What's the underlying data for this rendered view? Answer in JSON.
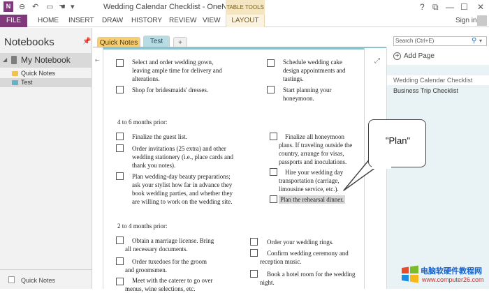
{
  "window": {
    "title": "Wedding Calendar Checklist - OneNote",
    "contextual_group": "TABLE TOOLS",
    "buttons": {
      "help": "?",
      "restore": "⧉",
      "minimize": "—",
      "maximize": "☐",
      "close": "✕"
    }
  },
  "ribbon": {
    "tabs": [
      "FILE",
      "HOME",
      "INSERT",
      "DRAW",
      "HISTORY",
      "REVIEW",
      "VIEW",
      "LAYOUT"
    ],
    "sign_in": "Sign in"
  },
  "notebooks": {
    "title": "Notebooks",
    "notebook": "My Notebook",
    "sections": [
      {
        "label": "Quick Notes",
        "color": "#f3c14f"
      },
      {
        "label": "Test",
        "color": "#5fb4c8"
      }
    ],
    "bottom_label": "Quick Notes"
  },
  "section_tabs": [
    {
      "label": "Quick Notes"
    },
    {
      "label": "Test"
    },
    {
      "label": "+"
    }
  ],
  "search": {
    "placeholder": "Search (Ctrl+E)"
  },
  "pages_pane": {
    "add_page": "Add Page",
    "pages": [
      "Wedding Calendar Checklist",
      "Business Trip Checklist"
    ]
  },
  "content": {
    "top_left": [
      "Select and order wedding gown,\nleaving ample time for delivery and\nalterations.",
      "Shop for bridesmaids' dresses."
    ],
    "top_right": [
      "Schedule wedding cake\ndesign appointments and\ntastings.",
      "Start planning your\nhoneymoon."
    ],
    "heading_1": "4 to 6 months prior:",
    "mid_left": [
      "Finalize the guest list.",
      "Order invitations (25 extra) and other\nwedding stationery (i.e., place cards and\nthank you notes).",
      "Plan wedding-day beauty preparations;\nask your stylist how far in advance they\nbook wedding parties, and whether they\nare willing to work on the wedding site."
    ],
    "mid_right": [
      "Finalize all honeymoon\nplans. If traveling outside the\ncountry, arrange for visas,\npassports and inoculations.",
      "Hire your wedding day\ntransportation (carriage,\nlimousine service, etc.).",
      "Plan the rehearsal dinner."
    ],
    "heading_2": "2 to 4 months prior:",
    "bottom_left": [
      "Obtain a marriage license. Bring\nall necessary documents.",
      "Order tuxedoes for the groom\nand groomsmen.",
      "Meet with the caterer to go over\nmenus, wine selections, etc."
    ],
    "bottom_right": [
      "Order your wedding rings.",
      "Confirm wedding ceremony and\nreception music.",
      "Book a hotel room for the wedding\nnight."
    ]
  },
  "callout": {
    "text": "\"Plan\""
  },
  "watermark": {
    "site_name": "电脑软硬件教程网",
    "url": "www.computer26.com"
  }
}
